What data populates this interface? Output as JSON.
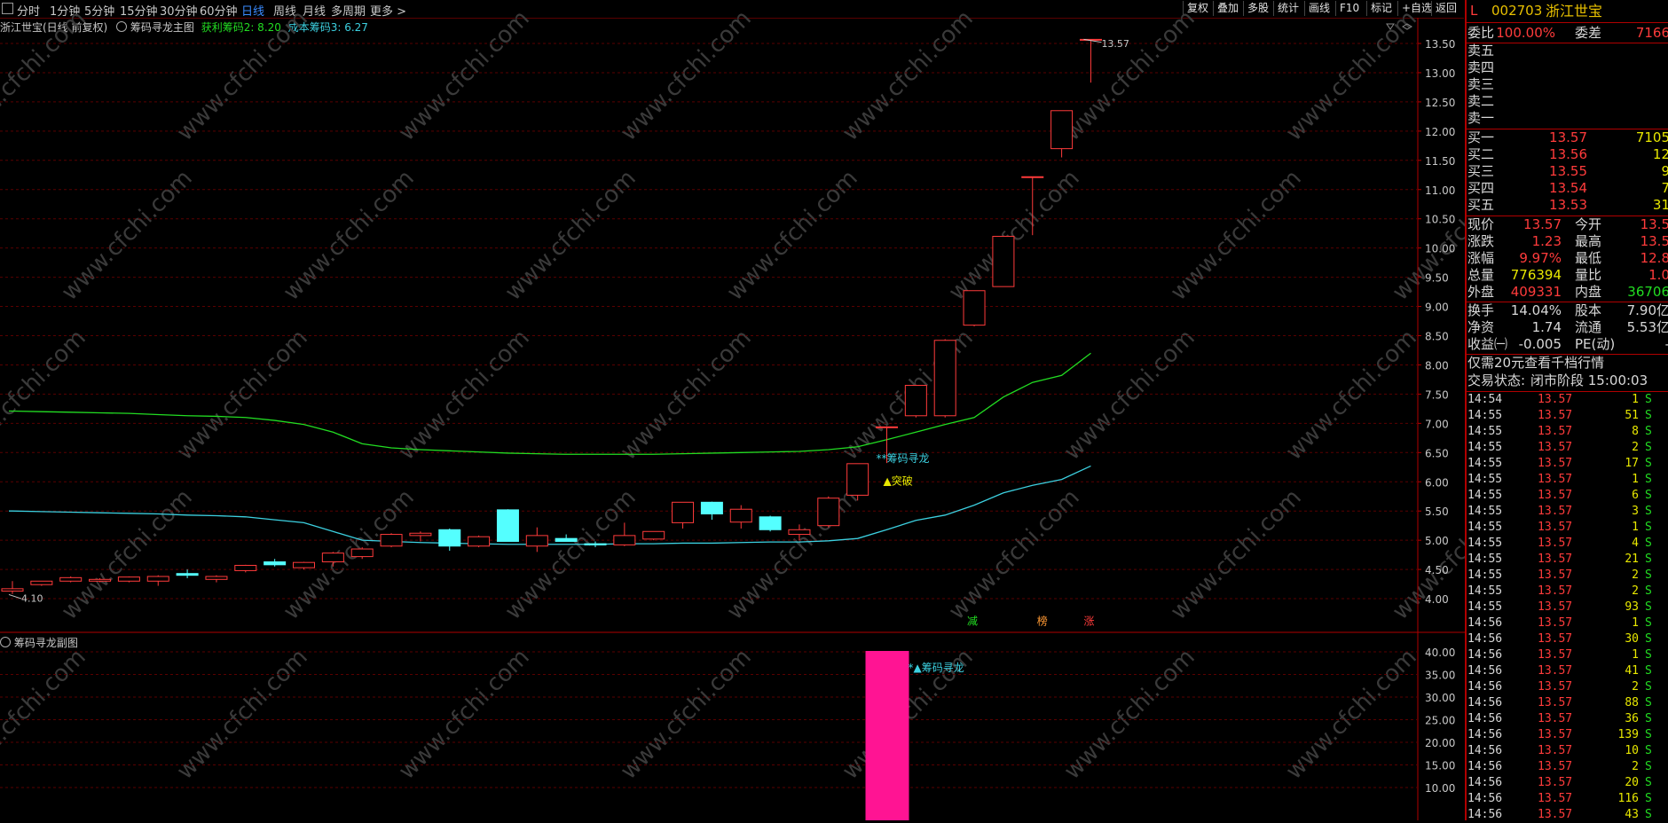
{
  "toolbar": {
    "periods": [
      "分时",
      "1分钟",
      "5分钟",
      "15分钟",
      "30分钟",
      "60分钟",
      "日线",
      "周线",
      "月线",
      "多周期",
      "更多 >"
    ],
    "active": "日线",
    "right_buttons": [
      "复权",
      "叠加",
      "多股",
      "统计",
      "画线",
      "F10",
      "标记",
      "+自选",
      "返回"
    ]
  },
  "main_header": {
    "stock_title": "浙江世宝(日线 前复权)",
    "indicator_name": "筹码寻龙主图",
    "profit_chip": "获利筹码2: 8.20",
    "cost_chip": "成本筹码3: 6.27"
  },
  "sub_header": {
    "indicator_name": "筹码寻龙副图"
  },
  "watermark": "www.cfchi.com",
  "colors": {
    "up": "#ff3b3b",
    "down": "#54ffff",
    "green_line": "#22dd22",
    "cyan_line": "#3cd0e0",
    "magenta": "#ff1493",
    "yellow": "#e8e800"
  },
  "chart_data": [
    {
      "type": "candlestick",
      "title": "筹码寻龙主图",
      "ylim": [
        3.6,
        13.7
      ],
      "yticks": [
        "13.50",
        "13.00",
        "12.50",
        "12.00",
        "11.50",
        "11.00",
        "10.50",
        "10.00",
        "9.50",
        "9.00",
        "8.50",
        "8.00",
        "7.50",
        "7.00",
        "6.50",
        "6.00",
        "5.50",
        "5.00",
        "4.50",
        "4.00"
      ],
      "candles": [
        {
          "o": 4.13,
          "h": 4.3,
          "l": 4.08,
          "c": 4.17
        },
        {
          "o": 4.24,
          "h": 4.3,
          "l": 4.22,
          "c": 4.3
        },
        {
          "o": 4.3,
          "h": 4.38,
          "l": 4.28,
          "c": 4.36
        },
        {
          "o": 4.3,
          "h": 4.35,
          "l": 4.28,
          "c": 4.33
        },
        {
          "o": 4.3,
          "h": 4.38,
          "l": 4.28,
          "c": 4.37
        },
        {
          "o": 4.3,
          "h": 4.4,
          "l": 4.22,
          "c": 4.38
        },
        {
          "o": 4.43,
          "h": 4.5,
          "l": 4.35,
          "c": 4.4
        },
        {
          "o": 4.33,
          "h": 4.4,
          "l": 4.28,
          "c": 4.38
        },
        {
          "o": 4.48,
          "h": 4.58,
          "l": 4.45,
          "c": 4.57
        },
        {
          "o": 4.63,
          "h": 4.68,
          "l": 4.55,
          "c": 4.58
        },
        {
          "o": 4.53,
          "h": 4.63,
          "l": 4.5,
          "c": 4.62
        },
        {
          "o": 4.63,
          "h": 4.8,
          "l": 4.55,
          "c": 4.78
        },
        {
          "o": 4.72,
          "h": 4.88,
          "l": 4.68,
          "c": 4.85
        },
        {
          "o": 4.9,
          "h": 5.12,
          "l": 4.88,
          "c": 5.1
        },
        {
          "o": 5.08,
          "h": 5.15,
          "l": 4.98,
          "c": 5.12
        },
        {
          "o": 5.18,
          "h": 5.2,
          "l": 4.82,
          "c": 4.9
        },
        {
          "o": 4.9,
          "h": 5.08,
          "l": 4.88,
          "c": 5.06
        },
        {
          "o": 5.52,
          "h": 5.53,
          "l": 4.98,
          "c": 4.98
        },
        {
          "o": 4.9,
          "h": 5.22,
          "l": 4.8,
          "c": 5.08
        },
        {
          "o": 5.03,
          "h": 5.1,
          "l": 4.98,
          "c": 4.98
        },
        {
          "o": 4.94,
          "h": 4.98,
          "l": 4.88,
          "c": 4.92
        },
        {
          "o": 4.92,
          "h": 5.3,
          "l": 4.9,
          "c": 5.08
        },
        {
          "o": 5.02,
          "h": 5.15,
          "l": 5.0,
          "c": 5.15
        },
        {
          "o": 5.3,
          "h": 5.65,
          "l": 5.2,
          "c": 5.65
        },
        {
          "o": 5.65,
          "h": 5.66,
          "l": 5.35,
          "c": 5.45
        },
        {
          "o": 5.31,
          "h": 5.6,
          "l": 5.2,
          "c": 5.53
        },
        {
          "o": 5.4,
          "h": 5.42,
          "l": 5.15,
          "c": 5.18
        },
        {
          "o": 5.1,
          "h": 5.27,
          "l": 5.0,
          "c": 5.18
        },
        {
          "o": 5.25,
          "h": 5.75,
          "l": 5.22,
          "c": 5.72
        },
        {
          "o": 5.77,
          "h": 6.31,
          "l": 5.68,
          "c": 6.31
        },
        {
          "o": 6.94,
          "h": 6.95,
          "l": 6.32,
          "c": 6.94
        },
        {
          "o": 7.13,
          "h": 7.65,
          "l": 7.1,
          "c": 7.65
        },
        {
          "o": 7.13,
          "h": 8.44,
          "l": 7.1,
          "c": 8.42
        },
        {
          "o": 8.68,
          "h": 9.27,
          "l": 8.66,
          "c": 9.27
        },
        {
          "o": 9.34,
          "h": 10.2,
          "l": 9.34,
          "c": 10.2
        },
        {
          "o": 11.22,
          "h": 11.22,
          "l": 10.22,
          "c": 11.22
        },
        {
          "o": 11.7,
          "h": 12.35,
          "l": 11.55,
          "c": 12.35
        },
        {
          "o": 13.57,
          "h": 13.57,
          "l": 12.83,
          "c": 13.57
        }
      ],
      "green_line": {
        "name": "获利筹码2",
        "values": [
          7.21,
          7.2,
          7.19,
          7.18,
          7.17,
          7.15,
          7.13,
          7.12,
          7.1,
          7.05,
          6.98,
          6.85,
          6.65,
          6.58,
          6.55,
          6.53,
          6.51,
          6.49,
          6.48,
          6.47,
          6.47,
          6.47,
          6.47,
          6.48,
          6.49,
          6.5,
          6.51,
          6.52,
          6.55,
          6.6,
          6.72,
          6.85,
          6.98,
          7.1,
          7.45,
          7.7,
          7.82,
          8.2
        ]
      },
      "cyan_line": {
        "name": "成本筹码3",
        "values": [
          5.5,
          5.49,
          5.48,
          5.47,
          5.46,
          5.45,
          5.43,
          5.42,
          5.4,
          5.35,
          5.3,
          5.15,
          5.0,
          4.98,
          4.96,
          4.95,
          4.94,
          4.93,
          4.93,
          4.93,
          4.93,
          4.94,
          4.94,
          4.95,
          4.95,
          4.96,
          4.97,
          4.97,
          4.99,
          5.03,
          5.18,
          5.34,
          5.43,
          5.6,
          5.81,
          5.94,
          6.04,
          6.27
        ]
      },
      "labels": {
        "max": "13.57",
        "min": "4.10",
        "signal": "**筹码寻龙",
        "breakout": "▲突破",
        "tag_a": "减",
        "tag_b": "榜",
        "tag_c": "涨"
      }
    },
    {
      "type": "bar",
      "title": "筹码寻龙副图",
      "ylim": [
        5,
        42
      ],
      "yticks": [
        "40.00",
        "35.00",
        "30.00",
        "25.00",
        "20.00",
        "15.00",
        "10.00"
      ],
      "bar_index": 30,
      "bar_value": 40,
      "signal": "*▲筹码寻龙"
    }
  ],
  "panel": {
    "mode": "L",
    "code": "002703",
    "name": "浙江世宝",
    "weibi_label": "委比",
    "weibi": "100.00%",
    "weicha_label": "委差",
    "weicha": "7166",
    "sell": [
      {
        "label": "卖五",
        "price": "",
        "vol": ""
      },
      {
        "label": "卖四",
        "price": "",
        "vol": ""
      },
      {
        "label": "卖三",
        "price": "",
        "vol": ""
      },
      {
        "label": "卖二",
        "price": "",
        "vol": ""
      },
      {
        "label": "卖一",
        "price": "",
        "vol": ""
      }
    ],
    "buy": [
      {
        "label": "买一",
        "price": "13.57",
        "vol": "7105"
      },
      {
        "label": "买二",
        "price": "13.56",
        "vol": "12"
      },
      {
        "label": "买三",
        "price": "13.55",
        "vol": "9"
      },
      {
        "label": "买四",
        "price": "13.54",
        "vol": "7"
      },
      {
        "label": "买五",
        "price": "13.53",
        "vol": "31"
      }
    ],
    "stats": [
      {
        "l1": "现价",
        "v1": "13.57",
        "c1": "#ff3b3b",
        "l2": "今开",
        "v2": "13.5",
        "c2": "#ff3b3b"
      },
      {
        "l1": "涨跌",
        "v1": "1.23",
        "c1": "#ff3b3b",
        "l2": "最高",
        "v2": "13.5",
        "c2": "#ff3b3b"
      },
      {
        "l1": "涨幅",
        "v1": "9.97%",
        "c1": "#ff3b3b",
        "l2": "最低",
        "v2": "12.8",
        "c2": "#ff3b3b"
      },
      {
        "l1": "总量",
        "v1": "776394",
        "c1": "#e8e800",
        "l2": "量比",
        "v2": "1.0",
        "c2": "#ff3b3b"
      },
      {
        "l1": "外盘",
        "v1": "409331",
        "c1": "#ff3b3b",
        "l2": "内盘",
        "v2": "36706",
        "c2": "#22dd22"
      }
    ],
    "fund": [
      {
        "l1": "换手",
        "v1": "14.04%",
        "l2": "股本",
        "v2": "7.90亿"
      },
      {
        "l1": "净资",
        "v1": "1.74",
        "l2": "流通",
        "v2": "5.53亿"
      },
      {
        "l1": "收益㈠",
        "v1": "-0.005",
        "l2": "PE(动)",
        "v2": "-"
      }
    ],
    "promo": "仅需20元查看千档行情",
    "status_label": "交易状态:",
    "status": "闭市阶段 15:00:03",
    "ticks": [
      {
        "t": "14:54",
        "p": "13.57",
        "v": "1",
        "d": "S"
      },
      {
        "t": "14:55",
        "p": "13.57",
        "v": "51",
        "d": "S"
      },
      {
        "t": "14:55",
        "p": "13.57",
        "v": "8",
        "d": "S"
      },
      {
        "t": "14:55",
        "p": "13.57",
        "v": "2",
        "d": "S"
      },
      {
        "t": "14:55",
        "p": "13.57",
        "v": "17",
        "d": "S"
      },
      {
        "t": "14:55",
        "p": "13.57",
        "v": "1",
        "d": "S"
      },
      {
        "t": "14:55",
        "p": "13.57",
        "v": "6",
        "d": "S"
      },
      {
        "t": "14:55",
        "p": "13.57",
        "v": "3",
        "d": "S"
      },
      {
        "t": "14:55",
        "p": "13.57",
        "v": "1",
        "d": "S"
      },
      {
        "t": "14:55",
        "p": "13.57",
        "v": "4",
        "d": "S"
      },
      {
        "t": "14:55",
        "p": "13.57",
        "v": "21",
        "d": "S"
      },
      {
        "t": "14:55",
        "p": "13.57",
        "v": "2",
        "d": "S"
      },
      {
        "t": "14:55",
        "p": "13.57",
        "v": "2",
        "d": "S"
      },
      {
        "t": "14:55",
        "p": "13.57",
        "v": "93",
        "d": "S"
      },
      {
        "t": "14:56",
        "p": "13.57",
        "v": "1",
        "d": "S"
      },
      {
        "t": "14:56",
        "p": "13.57",
        "v": "30",
        "d": "S"
      },
      {
        "t": "14:56",
        "p": "13.57",
        "v": "1",
        "d": "S"
      },
      {
        "t": "14:56",
        "p": "13.57",
        "v": "41",
        "d": "S"
      },
      {
        "t": "14:56",
        "p": "13.57",
        "v": "2",
        "d": "S"
      },
      {
        "t": "14:56",
        "p": "13.57",
        "v": "88",
        "d": "S"
      },
      {
        "t": "14:56",
        "p": "13.57",
        "v": "36",
        "d": "S"
      },
      {
        "t": "14:56",
        "p": "13.57",
        "v": "139",
        "d": "S"
      },
      {
        "t": "14:56",
        "p": "13.57",
        "v": "10",
        "d": "S"
      },
      {
        "t": "14:56",
        "p": "13.57",
        "v": "2",
        "d": "S"
      },
      {
        "t": "14:56",
        "p": "13.57",
        "v": "20",
        "d": "S"
      },
      {
        "t": "14:56",
        "p": "13.57",
        "v": "116",
        "d": "S"
      },
      {
        "t": "14:56",
        "p": "13.57",
        "v": "43",
        "d": "S"
      }
    ]
  }
}
